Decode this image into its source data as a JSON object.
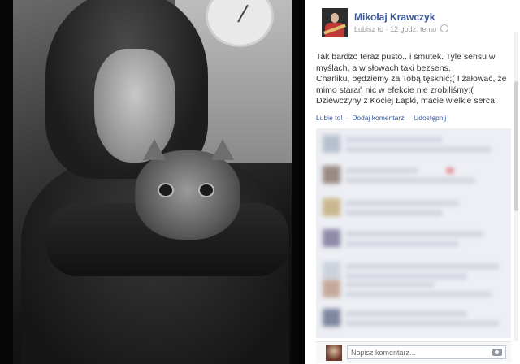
{
  "post": {
    "author": "Mikołaj Krawczyk",
    "meta": {
      "like_link": "Lubisz to",
      "separator": "·",
      "timestamp": "12 godz. temu"
    },
    "text": [
      "Tak bardzo teraz pusto.. i smutek. Tyle sensu w myślach, a w słowach taki bezsens.",
      "Charliku, będziemy za Tobą tęsknić;( I żałować, że mimo starań nic w efekcie nie zrobiliśmy;( Dziewczyny z Kociej Łapki, macie wielkie serca."
    ],
    "actions": {
      "like": "Lubię to!",
      "comment": "Dodaj komentarz",
      "share": "Udostępnij",
      "sep": "·"
    }
  },
  "reply": {
    "placeholder": "Napisz komentarz..."
  },
  "colors": {
    "link": "#3b5998",
    "comment_bg": "#edeff4"
  },
  "icons": [
    "guitar-avatar",
    "globe-icon",
    "camera-icon"
  ]
}
